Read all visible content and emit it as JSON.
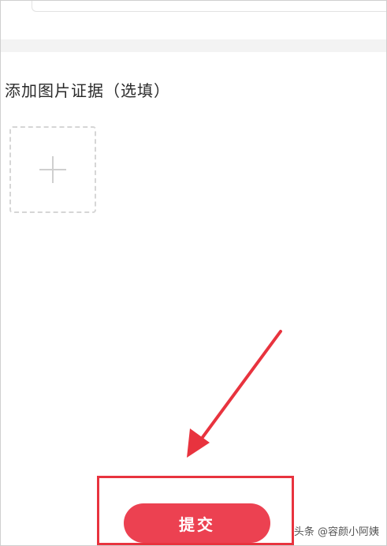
{
  "form": {
    "section_title": "添加图片证据（选填）",
    "upload_icon": "plus-icon",
    "submit_label": "提交"
  },
  "annotation": {
    "color": "#e8333e",
    "arrow_icon": "arrow-icon"
  },
  "theme": {
    "button_color": "#ec4151"
  },
  "watermark": {
    "text": "头条 @容颜小阿姨"
  }
}
